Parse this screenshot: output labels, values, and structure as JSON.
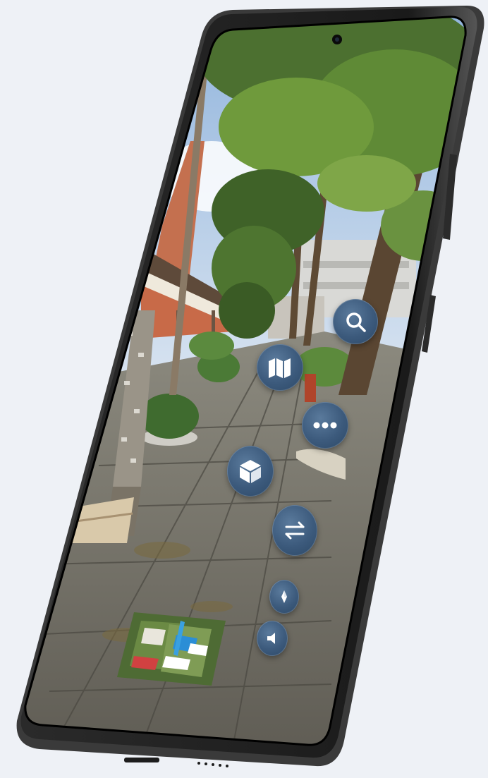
{
  "app": {
    "view": "street-panorama",
    "accent_color": "#3c5a7c"
  },
  "controls": [
    {
      "name": "search-button",
      "icon": "search-icon"
    },
    {
      "name": "map-button",
      "icon": "map-icon"
    },
    {
      "name": "more-options-button",
      "icon": "more-dots-icon"
    },
    {
      "name": "3d-view-button",
      "icon": "cube-icon"
    },
    {
      "name": "switch-view-button",
      "icon": "swap-arrows-icon"
    },
    {
      "name": "compass-button",
      "icon": "compass-icon"
    },
    {
      "name": "sound-button",
      "icon": "speaker-icon"
    }
  ],
  "minimap": {
    "icon": "campus-map-thumbnail",
    "bg_color": "#4e6b34"
  }
}
